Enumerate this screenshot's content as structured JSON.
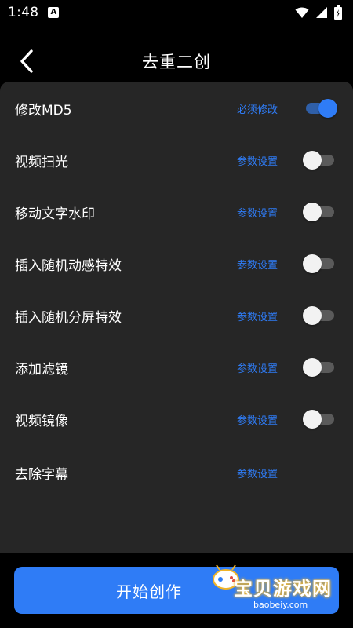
{
  "status_bar": {
    "time": "1:48",
    "notification_icon": "a-badge-icon",
    "icons": [
      "wifi-icon",
      "signal-icon",
      "battery-icon"
    ]
  },
  "header": {
    "title": "去重二创",
    "back_icon": "chevron-left-icon"
  },
  "settings": {
    "items": [
      {
        "label": "修改MD5",
        "action": "必须修改",
        "toggle": true
      },
      {
        "label": "视频扫光",
        "action": "参数设置",
        "toggle": false
      },
      {
        "label": "移动文字水印",
        "action": "参数设置",
        "toggle": false
      },
      {
        "label": "插入随机动感特效",
        "action": "参数设置",
        "toggle": false
      },
      {
        "label": "插入随机分屏特效",
        "action": "参数设置",
        "toggle": false
      },
      {
        "label": "添加滤镜",
        "action": "参数设置",
        "toggle": false
      },
      {
        "label": "视频镜像",
        "action": "参数设置",
        "toggle": false
      },
      {
        "label": "去除字幕",
        "action": "参数设置"
      }
    ]
  },
  "footer": {
    "start_label": "开始创作"
  },
  "watermark": {
    "text": "宝贝游戏网",
    "url": "baobeiy.com"
  },
  "colors": {
    "accent": "#2f7cf6",
    "panel": "#262626",
    "background": "#000000"
  }
}
